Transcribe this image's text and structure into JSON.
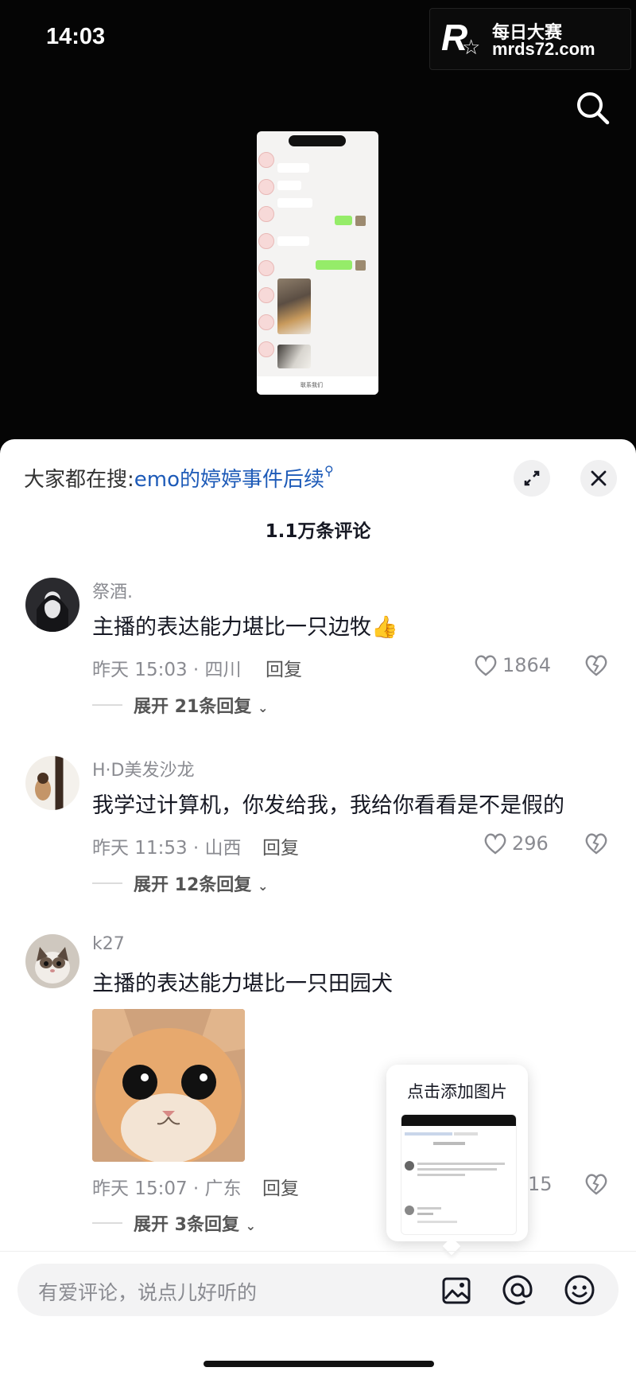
{
  "status_bar": {
    "time": "14:03"
  },
  "watermark": {
    "logo": "R",
    "line1": "每日大赛",
    "line2": "mrds72.com"
  },
  "video": {
    "thumbnail_bottom_label": "联系我们"
  },
  "sheet": {
    "suggest_prefix": "大家都在搜:",
    "suggest_query": "emo的婷婷事件后续",
    "comment_count": "1.1万条评论",
    "comments": [
      {
        "username": "祭酒.",
        "text": "主播的表达能力堪比一只边牧👍",
        "meta": "昨天 15:03 · 四川",
        "reply": "回复",
        "likes": "1864",
        "expand": "展开 21条回复"
      },
      {
        "username": "H·D美发沙龙",
        "text": "我学过计算机，你发给我，我给你看看是不是假的",
        "meta": "昨天 11:53 · 山西",
        "reply": "回复",
        "likes": "296",
        "expand": "展开 12条回复"
      },
      {
        "username": "k27",
        "text": "主播的表达能力堪比一只田园犬",
        "meta": "昨天 15:07 · 广东",
        "reply": "回复",
        "likes": "15",
        "expand": "展开 3条回复"
      }
    ],
    "popup_title": "点击添加图片",
    "input_placeholder": "有爱评论，说点儿好听的"
  },
  "icons": [
    "search-icon",
    "expand-icon",
    "close-icon",
    "heart-icon",
    "dislike-icon",
    "image-icon",
    "at-icon",
    "emoji-icon",
    "chevron-down-icon"
  ]
}
